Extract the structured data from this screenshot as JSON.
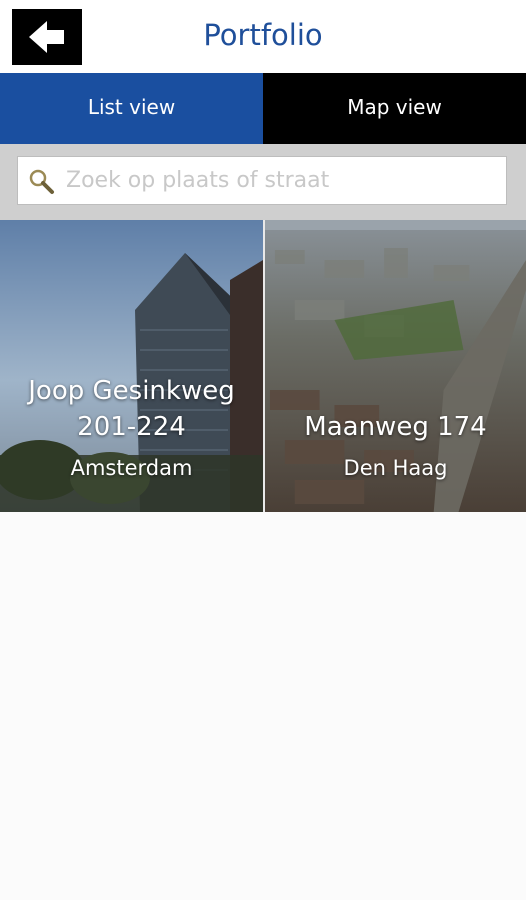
{
  "header": {
    "title": "Portfolio",
    "back_icon": "arrow-left-icon"
  },
  "tabs": [
    {
      "label": "List view",
      "active": true
    },
    {
      "label": "Map view",
      "active": false
    }
  ],
  "search": {
    "placeholder": "Zoek op plaats of straat",
    "value": "",
    "icon": "search-icon"
  },
  "properties": [
    {
      "name_line1": "Joop Gesinkweg",
      "name_line2": "201-224",
      "city": "Amsterdam"
    },
    {
      "name_line1": "Maanweg 174",
      "city": "Den Haag"
    }
  ],
  "colors": {
    "accent": "#1a4fa0",
    "title": "#1f4f9a",
    "tab_inactive": "#000000",
    "search_bg": "#cfcfcf"
  }
}
